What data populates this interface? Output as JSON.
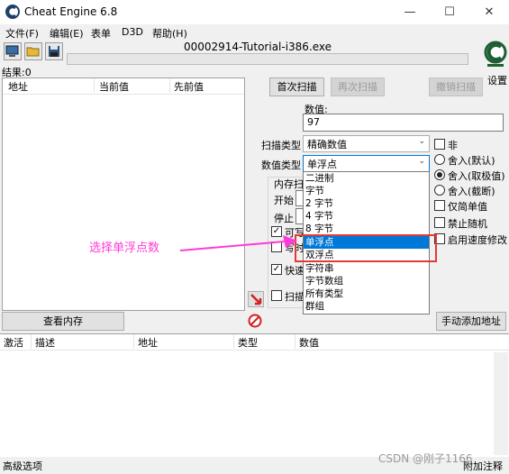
{
  "window": {
    "title": "Cheat Engine 6.8",
    "minimize": "—",
    "maximize": "☐",
    "close": "✕"
  },
  "menu": [
    "文件(F)",
    "编辑(E)",
    "表单",
    "D3D",
    "帮助(H)"
  ],
  "toolbar": {
    "process_name": "00002914-Tutorial-i386.exe",
    "settings_label": "设置"
  },
  "results_label": "结果:0",
  "found_list": {
    "columns": [
      "地址",
      "当前值",
      "先前值"
    ]
  },
  "scan": {
    "first_scan": "首次扫描",
    "next_scan": "再次扫描",
    "undo_scan": "撤销扫描",
    "value_label": "数值:",
    "value": "97",
    "scan_type_label": "扫描类型",
    "scan_type_value": "精确数值",
    "value_type_label": "数值类型",
    "value_type_value": "单浮点",
    "memory_scan_partial": "内存扫",
    "start_label": "开始",
    "stop_label": "停止",
    "writable_partial": "可写",
    "copyonwrite_partial": "写时",
    "fastscan_partial": "快速",
    "pause_partial": "扫描"
  },
  "options": {
    "not_label": "非",
    "rounded_default": "舍入(默认)",
    "rounded_extreme": "舍入(取极值)",
    "truncated": "舍入(截断)",
    "simple_only": "仅简单值",
    "unrandomizer": "禁止随机",
    "speedhack": "启用速度修改"
  },
  "dropdown_items": [
    "二进制",
    "字节",
    "2 字节",
    "4 字节",
    "8 字节",
    "单浮点",
    "双浮点",
    "字符串",
    "字节数组",
    "所有类型",
    "群组"
  ],
  "dropdown_selected": "单浮点",
  "annotation": {
    "text": "选择单浮点数",
    "color": "#ff3ad8",
    "box_color": "#e53935"
  },
  "buttons": {
    "memory_view": "查看内存",
    "add_address": "手动添加地址"
  },
  "address_list": {
    "columns": [
      "激活",
      "描述",
      "地址",
      "类型",
      "数值"
    ]
  },
  "status": {
    "advanced": "高级选项",
    "comments": "附加注释",
    "watermark": "CSDN @刚子1166"
  }
}
